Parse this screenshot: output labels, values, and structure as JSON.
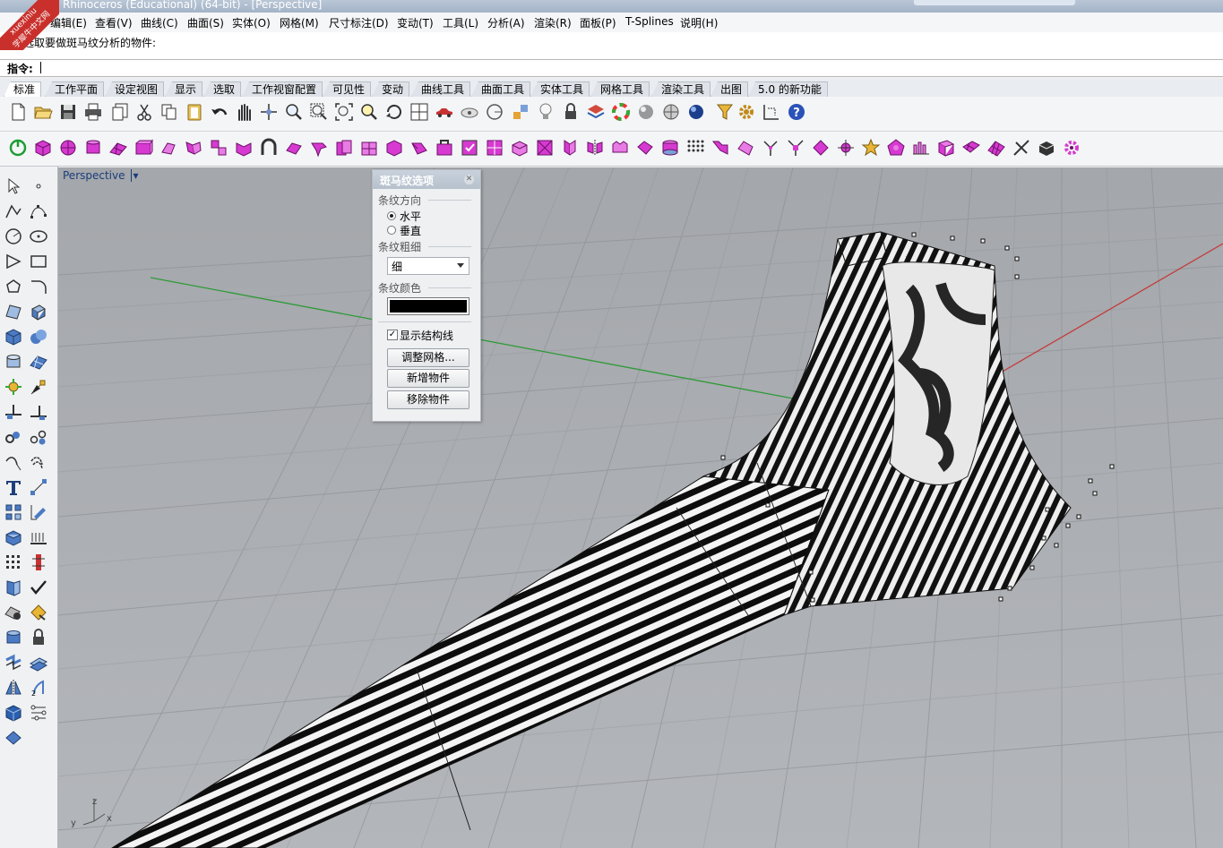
{
  "window": {
    "title": "Rhinoceros (Educational) (64-bit) - [Perspective]"
  },
  "watermark": {
    "line1": "xuexiniu",
    "line2": "学犀牛中文网"
  },
  "menu": [
    {
      "label": "编辑(E)"
    },
    {
      "label": "查看(V)"
    },
    {
      "label": "曲线(C)"
    },
    {
      "label": "曲面(S)"
    },
    {
      "label": "实体(O)"
    },
    {
      "label": "网格(M)"
    },
    {
      "label": "尺寸标注(D)"
    },
    {
      "label": "变动(T)"
    },
    {
      "label": "工具(L)"
    },
    {
      "label": "分析(A)"
    },
    {
      "label": "渲染(R)"
    },
    {
      "label": "面板(P)"
    },
    {
      "label": "T-Splines"
    },
    {
      "label": "说明(H)"
    }
  ],
  "command": {
    "history": "选取要做斑马纹分析的物件:",
    "prompt_label": "指令:"
  },
  "tabs": [
    {
      "label": "标准",
      "active": true
    },
    {
      "label": "工作平面"
    },
    {
      "label": "设定视图"
    },
    {
      "label": "显示"
    },
    {
      "label": "选取"
    },
    {
      "label": "工作视窗配置"
    },
    {
      "label": "可见性"
    },
    {
      "label": "变动"
    },
    {
      "label": "曲线工具"
    },
    {
      "label": "曲面工具"
    },
    {
      "label": "实体工具"
    },
    {
      "label": "网格工具"
    },
    {
      "label": "渲染工具"
    },
    {
      "label": "出图"
    },
    {
      "label": "5.0 的新功能"
    }
  ],
  "viewport": {
    "name": "Perspective"
  },
  "zebra_panel": {
    "title": "斑马纹选项",
    "direction_label": "条纹方向",
    "horizontal": "水平",
    "vertical": "垂直",
    "thickness_label": "条纹粗细",
    "thickness_value": "细",
    "color_label": "条纹颜色",
    "stripe_color": "#000000",
    "show_isocurves": "显示结构线",
    "adjust_mesh": "调整网格...",
    "add_object": "新增物件",
    "remove_object": "移除物件"
  },
  "axes": {
    "z": "z",
    "y": "y",
    "x": "x"
  }
}
